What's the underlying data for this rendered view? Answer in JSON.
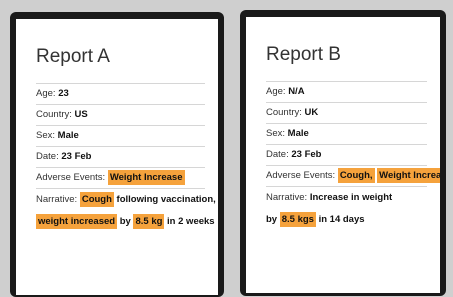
{
  "report_a": {
    "title": "Report A",
    "age_label": "Age:",
    "age_value": "23",
    "country_label": "Country:",
    "country_value": "US",
    "sex_label": "Sex:",
    "sex_value": "Male",
    "date_label": "Date:",
    "date_value": "23 Feb",
    "adverse_label": "Adverse Events:",
    "adverse_value": "Weight Increase",
    "narrative_label": "Narrative:",
    "narrative_hl1": "Cough",
    "narrative_t1": "following vaccination,",
    "narrative_hl2": "weight increased",
    "narrative_t2": "by",
    "narrative_hl3": "8.5 kg",
    "narrative_t3": "in 2 weeks"
  },
  "report_b": {
    "title": "Report B",
    "age_label": "Age:",
    "age_value": "N/A",
    "country_label": "Country:",
    "country_value": "UK",
    "sex_label": "Sex:",
    "sex_value": "Male",
    "date_label": "Date:",
    "date_value": "23 Feb",
    "adverse_label": "Adverse Events:",
    "adverse_hl1": "Cough,",
    "adverse_hl2": "Weight Increase",
    "narrative_label": "Narrative:",
    "narrative_t1": "Increase in weight",
    "narrative_t2": "by",
    "narrative_hl1": "8.5 kgs",
    "narrative_t3": "in 14 days"
  },
  "colors": {
    "highlight": "#f5a23c",
    "frame": "#1a1a1a",
    "background": "#cfcfcf"
  }
}
